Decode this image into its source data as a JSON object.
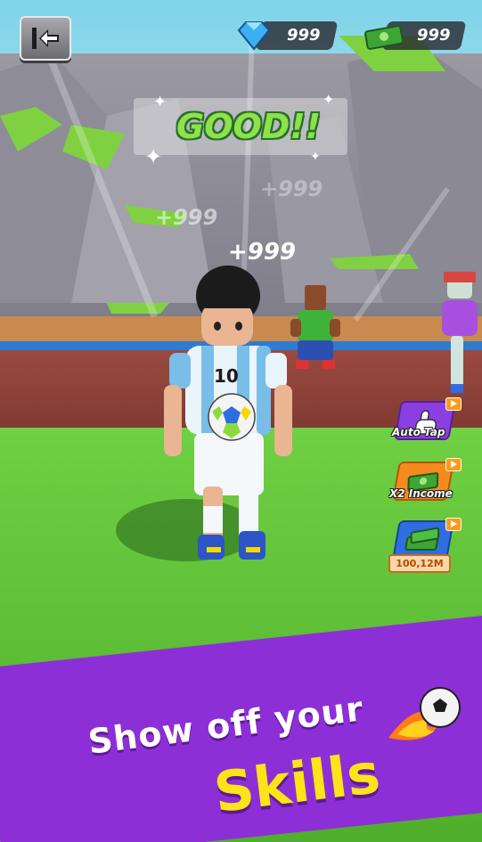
{
  "hud": {
    "back_icon": "back-arrow-icon",
    "gems": {
      "icon": "diamond-icon",
      "value": "999"
    },
    "cash": {
      "icon": "cash-stack-icon",
      "value": "999"
    }
  },
  "feedback": {
    "rating": "GOOD!!",
    "popups": [
      "+999",
      "+999",
      "+999"
    ]
  },
  "player": {
    "jersey_number": "10"
  },
  "side_buttons": [
    {
      "label": "Auto Tap",
      "icon": "tap-hand-icon",
      "color": "#8c3fe0"
    },
    {
      "label": "X2 Income",
      "icon": "cash-stack-icon",
      "color": "#f58a1e"
    },
    {
      "label": "100,12M",
      "icon": "cash-pile-icon",
      "color": "#2f6ee0"
    }
  ],
  "promo": {
    "line1": "Show off your",
    "line2": "Skills"
  },
  "colors": {
    "banner": "#8d2fd6",
    "headline_yellow": "#ffe319",
    "good_green": "#8fe14a"
  }
}
